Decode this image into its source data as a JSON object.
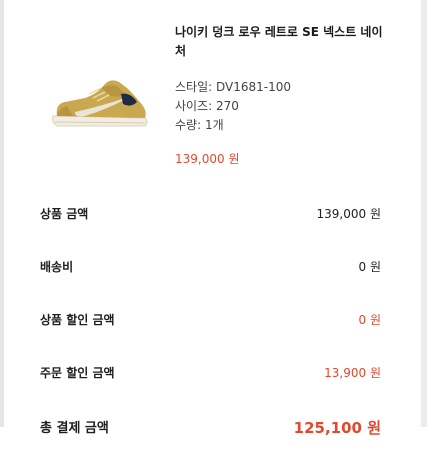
{
  "product": {
    "name": "나이키 덩크 로우 레트로 SE 넥스트 네이처",
    "style": "스타일: DV1681-100",
    "size": "사이즈: 270",
    "quantity": "수량: 1개",
    "price": "139,000 원",
    "image": "sneaker-image"
  },
  "summary": {
    "rows": [
      {
        "label": "상품 금액",
        "value": "139,000 원"
      },
      {
        "label": "배송비",
        "value": "0 원"
      },
      {
        "label": "상품 할인 금액",
        "value": "0 원"
      },
      {
        "label": "주문 할인 금액",
        "value": "13,900 원"
      },
      {
        "label": "총 결제 금액",
        "value": "125,100 원"
      }
    ]
  },
  "colors": {
    "accent": "#e2482e",
    "text": "#222222",
    "shoe_upper": "#c9a84f",
    "shoe_sole": "#f2ede0"
  }
}
